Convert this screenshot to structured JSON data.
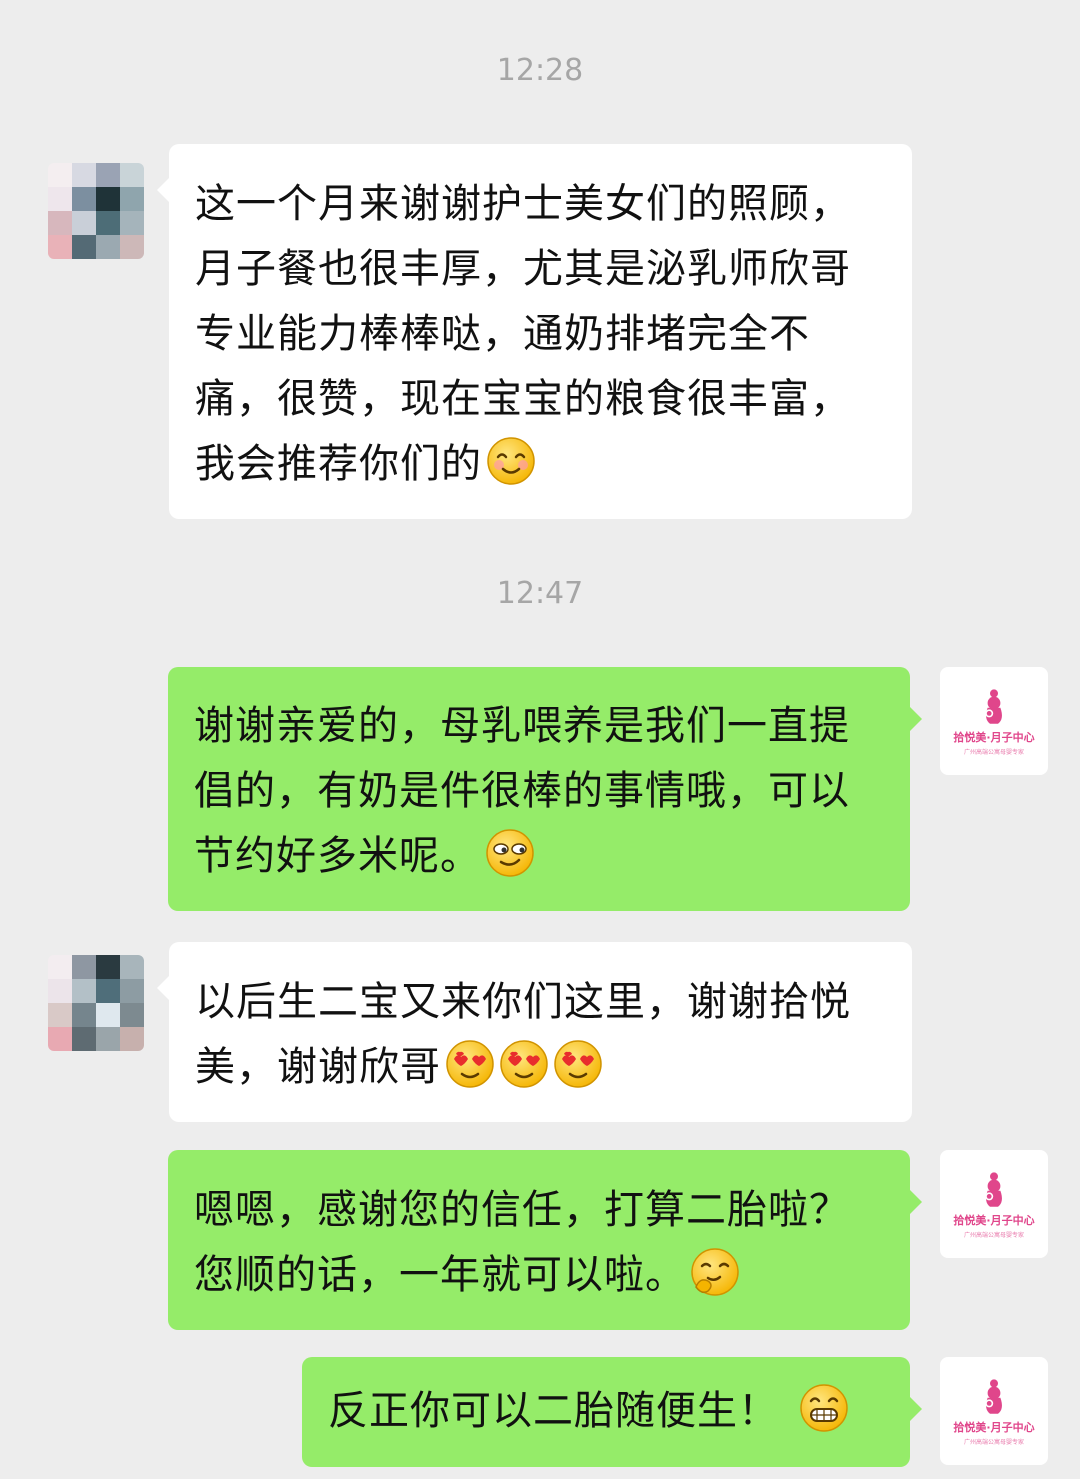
{
  "chat": {
    "timestamps": [
      "12:28",
      "12:47"
    ],
    "messages": [
      {
        "side": "left",
        "text": "这一个月来谢谢护士美女们的照顾，月子餐也很丰厚，尤其是泌乳师欣哥专业能力棒棒哒，通奶排堵完全不痛，很赞，现在宝宝的粮食很丰富，我会推荐你们的",
        "emojis": [
          "smile-emoji"
        ]
      },
      {
        "side": "right",
        "text": "谢谢亲爱的，母乳喂养是我们一直提倡的，有奶是件很棒的事情哦，可以节约好多米呢。",
        "emojis": [
          "smirk-emoji"
        ]
      },
      {
        "side": "left",
        "text": "以后生二宝又来你们这里，谢谢拾悦美，谢谢欣哥",
        "emojis": [
          "heart-eyes-emoji",
          "heart-eyes-emoji",
          "heart-eyes-emoji"
        ]
      },
      {
        "side": "right",
        "text": "嗯嗯，感谢您的信任，打算二胎啦？您顺的话，一年就可以啦。",
        "emojis": [
          "hmm-emoji"
        ]
      },
      {
        "side": "right",
        "text": "反正你可以二胎随便生！",
        "emojis": [
          "grin-emoji"
        ]
      }
    ]
  },
  "brand": {
    "logo_text": "拾悦美·月子中心",
    "logo_sub": "广州高端公寓母婴专家",
    "color": "#e0468b"
  },
  "colors": {
    "background": "#ededed",
    "incoming_bubble": "#ffffff",
    "outgoing_bubble": "#95ec69"
  }
}
